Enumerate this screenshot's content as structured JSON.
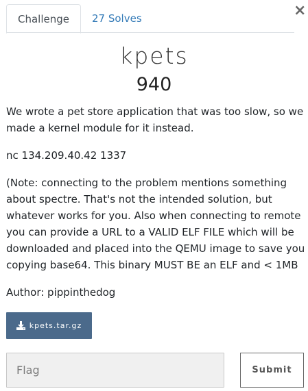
{
  "tabs": [
    {
      "label": "Challenge",
      "active": true
    },
    {
      "label": "27 Solves",
      "active": false
    }
  ],
  "close_label": "×",
  "challenge": {
    "name": "kpets",
    "points": "940",
    "description": [
      "We wrote a pet store application that was too slow, so we made a kernel module for it instead.",
      "nc 134.209.40.42 1337",
      "(Note: connecting to the problem mentions something about spectre. That's not the intended solution, but whatever works for you. Also when connecting to remote you can provide a URL to a VALID ELF FILE which will be downloaded and placed into the QEMU image to save you copying base64. This binary MUST BE an ELF and < 1MB",
      "Author: pippinthedog"
    ],
    "file_label": "kpets.tar.gz",
    "file_icon": "download-icon"
  },
  "form": {
    "flag_placeholder": "Flag",
    "flag_value": "",
    "submit_label": "Submit"
  },
  "colors": {
    "download_button_bg": "#4b6a8b",
    "tab_link": "#337ab7"
  }
}
